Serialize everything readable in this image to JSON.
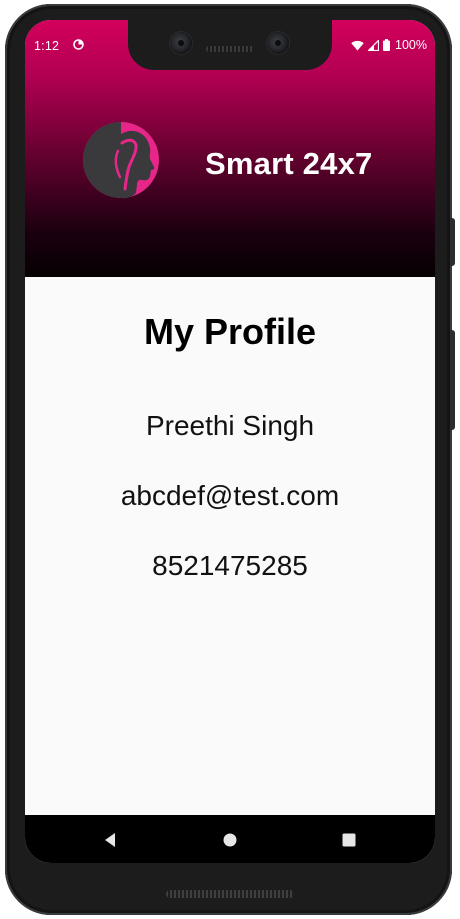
{
  "status_bar": {
    "time": "1:12",
    "battery": "100%",
    "app_icon": "data-saver-icon",
    "icons": [
      "wifi-icon",
      "cell-signal-icon",
      "battery-icon"
    ]
  },
  "header": {
    "app_title": "Smart 24x7",
    "logo_icon": "woman-face-logo",
    "gradient_colors": [
      "#d3005c",
      "#5e012c",
      "#050002"
    ]
  },
  "profile": {
    "title": "My Profile",
    "name": "Preethi Singh",
    "email": "abcdef@test.com",
    "phone": "8521475285"
  },
  "nav_bar": {
    "buttons": [
      "back-icon",
      "home-icon",
      "recents-icon"
    ]
  },
  "colors": {
    "accent": "#d3005c",
    "logo_pink": "#e8268a",
    "logo_gray": "#3a3a3d",
    "background": "#fafafa",
    "nav_bar": "#000000"
  }
}
